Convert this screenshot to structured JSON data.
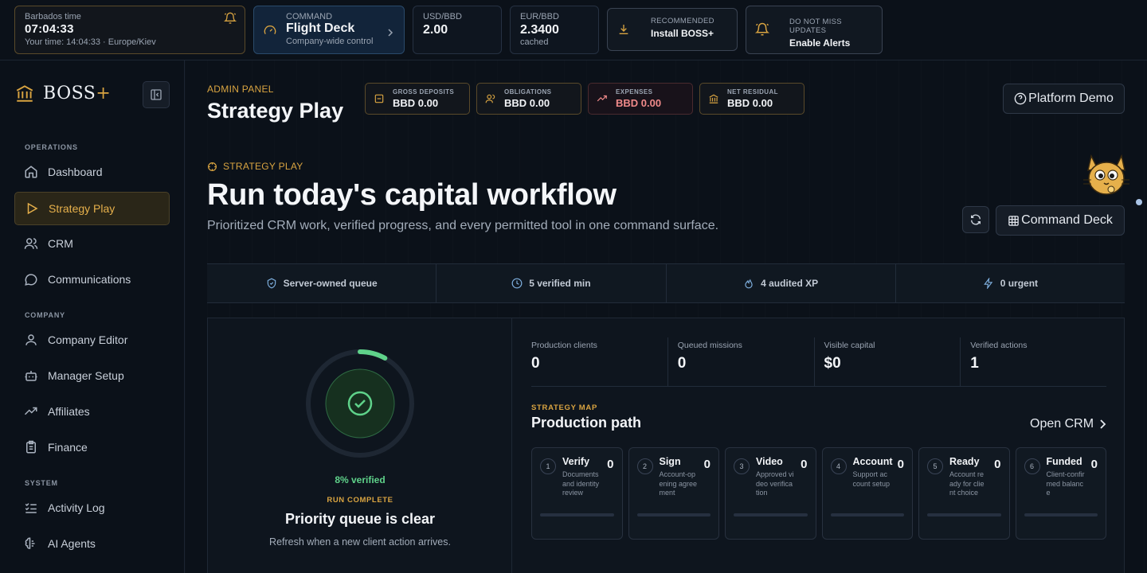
{
  "topbar": {
    "time": {
      "label": "Barbados time",
      "value": "07:04:33",
      "local": "Your time: 14:04:33 · Europe/Kiev"
    },
    "command": {
      "label": "COMMAND",
      "title": "Flight Deck",
      "sub": "Company-wide control"
    },
    "fx": [
      {
        "pair": "USD/BBD",
        "value": "2.00",
        "note": ""
      },
      {
        "pair": "EUR/BBD",
        "value": "2.3400",
        "note": "cached"
      }
    ],
    "install": {
      "label": "RECOMMENDED",
      "title": "Install BOSS+"
    },
    "alerts": {
      "label": "DO NOT MISS UPDATES",
      "title": "Enable Alerts"
    }
  },
  "sidebar": {
    "brand": {
      "name": "BOSS",
      "plus": "+"
    },
    "sections": [
      {
        "label": "OPERATIONS",
        "items": [
          "Dashboard",
          "Strategy Play",
          "CRM",
          "Communications"
        ]
      },
      {
        "label": "COMPANY",
        "items": [
          "Company Editor",
          "Manager Setup",
          "Affiliates",
          "Finance"
        ]
      },
      {
        "label": "SYSTEM",
        "items": [
          "Activity Log",
          "AI Agents"
        ]
      }
    ],
    "active": "Strategy Play"
  },
  "header": {
    "admin_label": "ADMIN PANEL",
    "title": "Strategy Play",
    "metrics": [
      {
        "label": "GROSS DEPOSITS",
        "value": "BBD 0.00",
        "icon": "document-icon"
      },
      {
        "label": "OBLIGATIONS",
        "value": "BBD 0.00",
        "icon": "users-icon"
      },
      {
        "label": "EXPENSES",
        "value": "BBD 0.00",
        "icon": "trending-icon"
      },
      {
        "label": "NET RESIDUAL",
        "value": "BBD 0.00",
        "icon": "bank-icon"
      }
    ],
    "demo_button": "Platform Demo"
  },
  "hero": {
    "kicker": "STRATEGY PLAY",
    "title": "Run today's capital workflow",
    "subtitle": "Prioritized CRM work, verified progress, and every permitted tool in one command surface.",
    "deck_button": "Command Deck"
  },
  "status": [
    {
      "text": "Server-owned queue",
      "icon": "shield-icon"
    },
    {
      "text": "5 verified min",
      "icon": "clock-icon"
    },
    {
      "text": "4 audited XP",
      "icon": "flame-icon"
    },
    {
      "text": "0 urgent",
      "icon": "bolt-icon"
    }
  ],
  "progress": {
    "percent": 8,
    "verified_text": "8% verified",
    "state": "RUN COMPLETE",
    "title": "Priority queue is clear",
    "subtitle": "Refresh when a new client action arrives."
  },
  "kpis": [
    {
      "label": "Production clients",
      "value": "0"
    },
    {
      "label": "Queued missions",
      "value": "0"
    },
    {
      "label": "Visible capital",
      "value": "$0"
    },
    {
      "label": "Verified actions",
      "value": "1"
    }
  ],
  "strategy_map": {
    "kicker": "STRATEGY MAP",
    "title": "Production path",
    "open_crm": "Open CRM",
    "steps": [
      {
        "num": "1",
        "name": "Verify",
        "count": "0",
        "desc": "Documents and identity review"
      },
      {
        "num": "2",
        "name": "Sign",
        "count": "0",
        "desc": "Account-opening agreement"
      },
      {
        "num": "3",
        "name": "Video",
        "count": "0",
        "desc": "Approved video verification"
      },
      {
        "num": "4",
        "name": "Account",
        "count": "0",
        "desc": "Support account setup"
      },
      {
        "num": "5",
        "name": "Ready",
        "count": "0",
        "desc": "Account ready for client choice"
      },
      {
        "num": "6",
        "name": "Funded",
        "count": "0",
        "desc": "Client-confirmed balance"
      }
    ]
  },
  "colors": {
    "accent": "#d9a441",
    "success": "#5fd28a",
    "danger": "#f08a8a",
    "bg": "#0b1119"
  }
}
